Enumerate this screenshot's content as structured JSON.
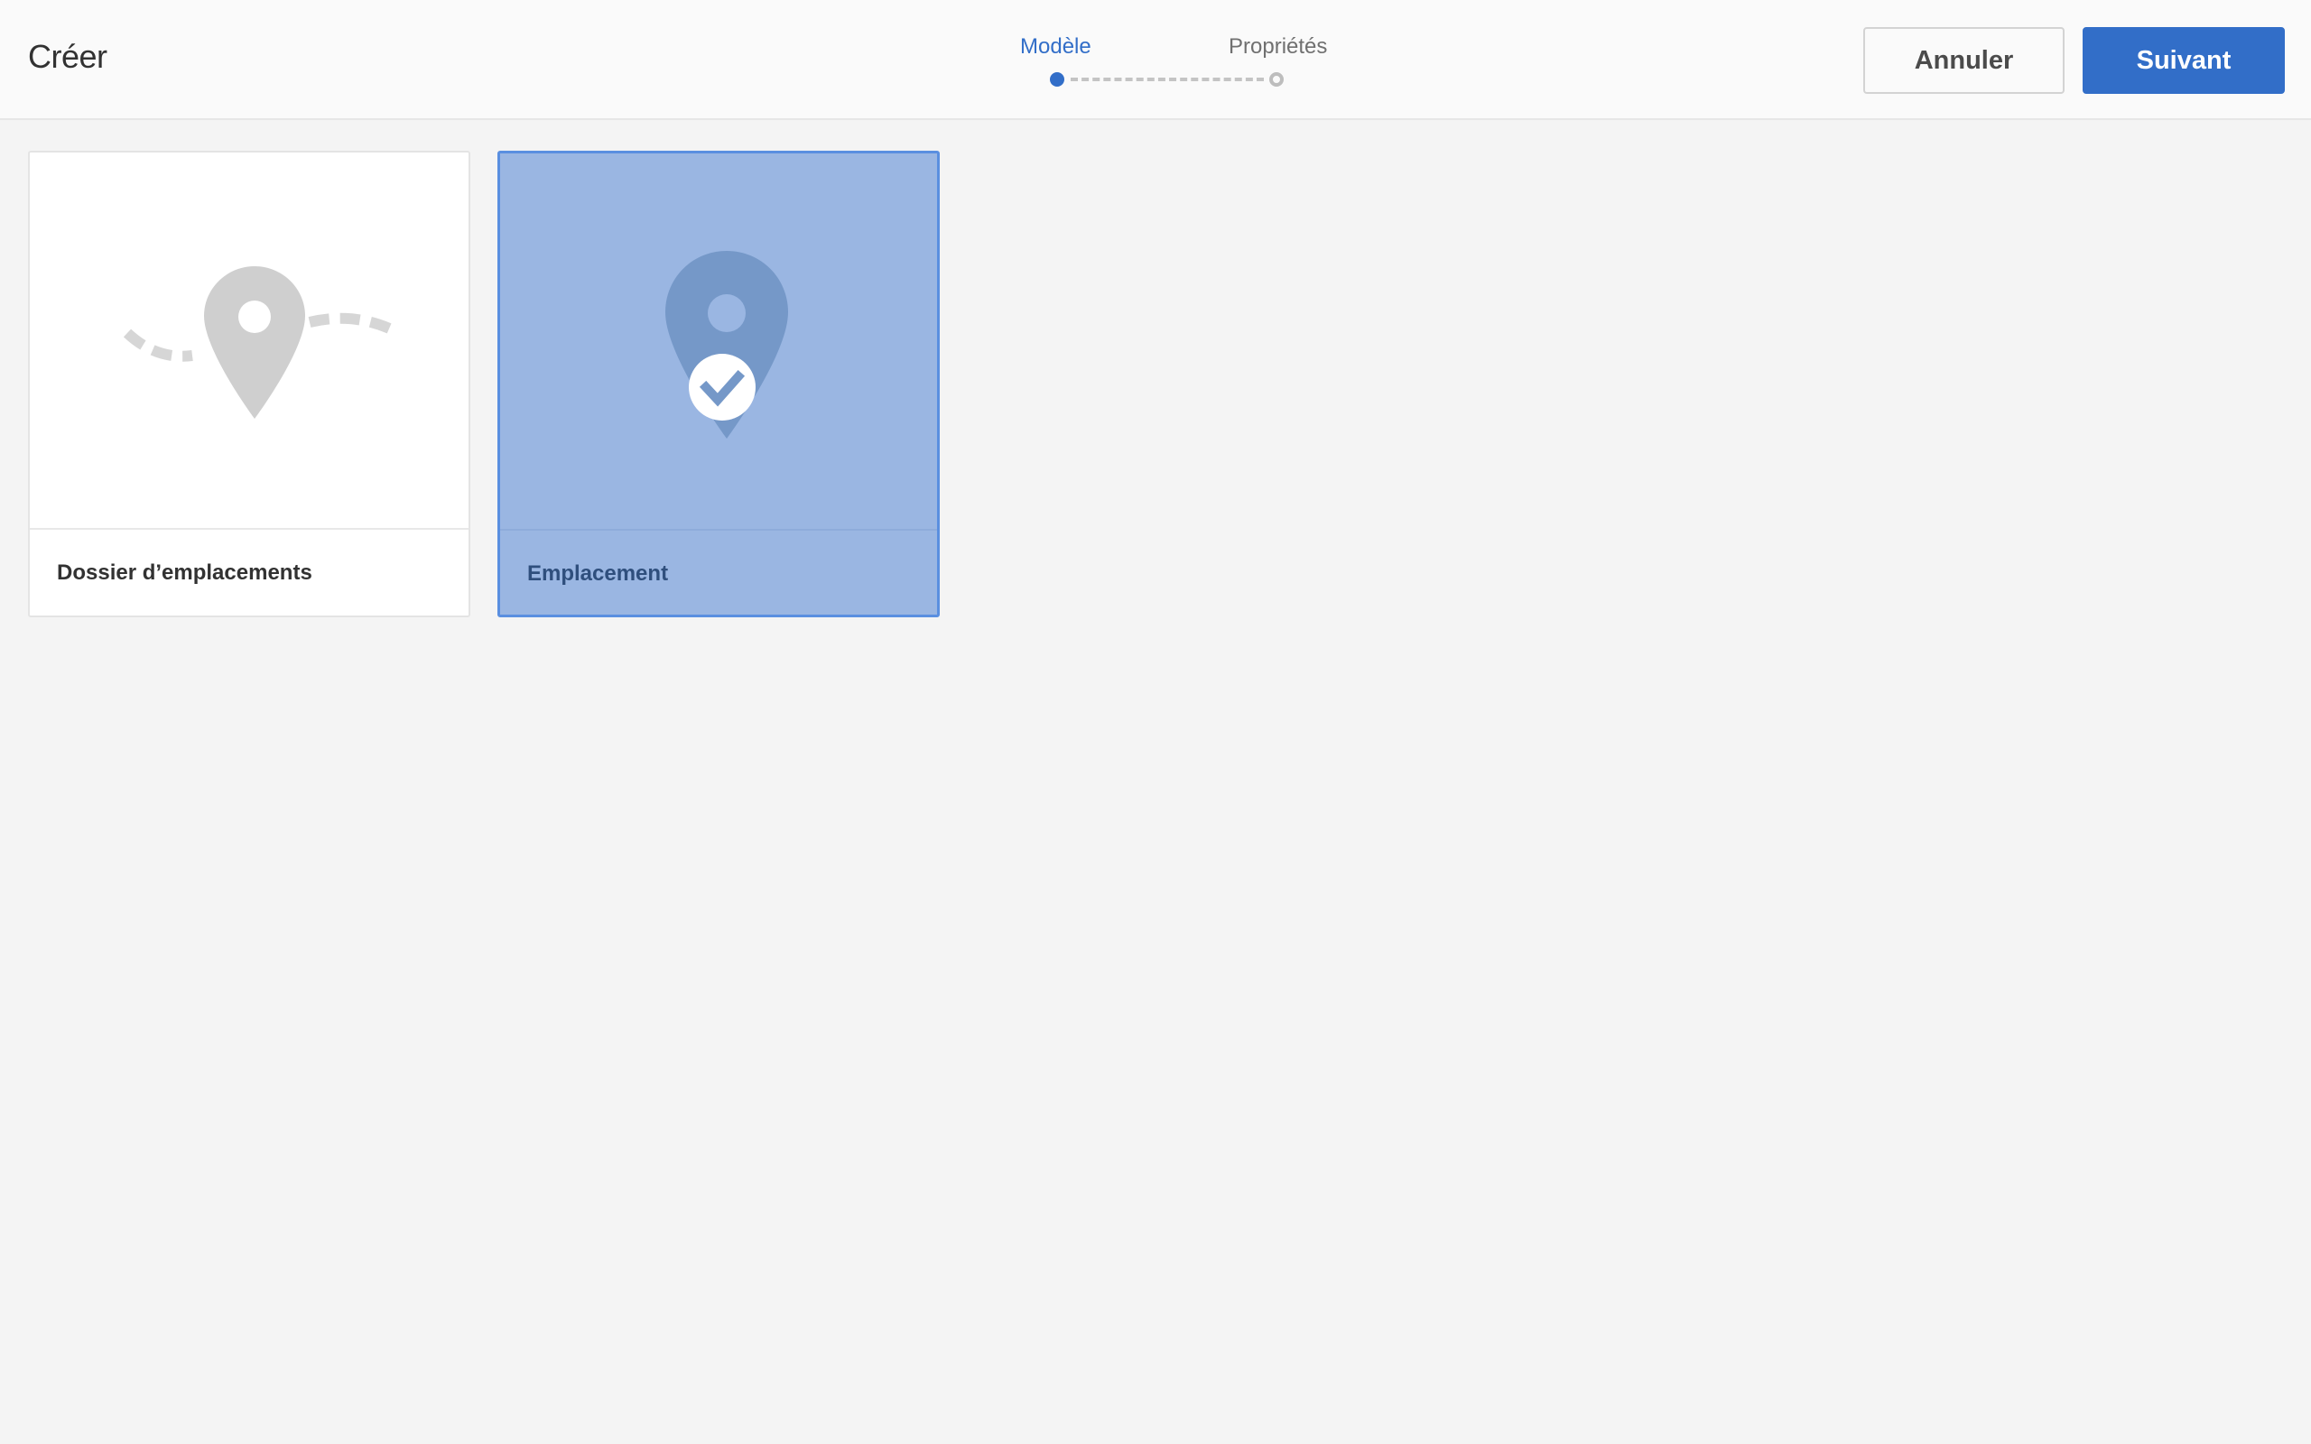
{
  "header": {
    "title": "Créer",
    "steps": [
      {
        "label": "Modèle",
        "state": "active"
      },
      {
        "label": "Propriétés",
        "state": "inactive"
      }
    ],
    "cancel_label": "Annuler",
    "next_label": "Suivant"
  },
  "cards": [
    {
      "label": "Dossier d’emplacements",
      "icon": "location-folder-icon",
      "selected": false
    },
    {
      "label": "Emplacement",
      "icon": "location-pin-icon",
      "selected": true
    }
  ],
  "colors": {
    "accent": "#326ec8",
    "selected_card": "#9ab6e2",
    "background": "#f4f4f4"
  }
}
